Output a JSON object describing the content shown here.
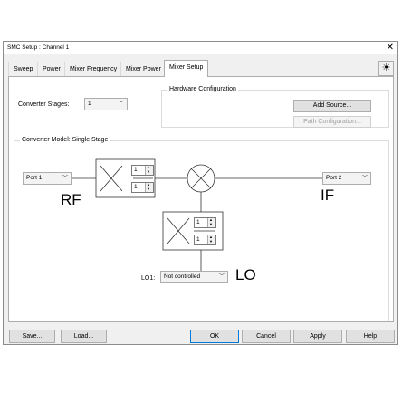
{
  "window": {
    "title": "SMC Setup : Channel 1",
    "close_icon": "✕"
  },
  "tabs": [
    "Sweep",
    "Power",
    "Mixer Frequency",
    "Mixer Power",
    "Mixer Setup"
  ],
  "active_tab": "Mixer Setup",
  "sun_icon": "☀",
  "converter_stages": {
    "label": "Converter Stages:",
    "value": "1"
  },
  "hardware": {
    "title": "Hardware Configuration",
    "add_source": "Add Source...",
    "path_configuration": "Path Configuration..."
  },
  "model": {
    "title": "Converter Model: Single Stage",
    "port_in": "Port 1",
    "port_out": "Port 2",
    "rf_label": "RF",
    "if_label": "IF",
    "lo_label": "LO",
    "lo1_label": "LO1:",
    "lo1_value": "Not controlled",
    "mult1_num": "1",
    "mult1_den": "1",
    "mult2_num": "1",
    "mult2_den": "1"
  },
  "footer": {
    "save": "Save...",
    "load": "Load...",
    "ok": "OK",
    "cancel": "Cancel",
    "apply": "Apply",
    "help": "Help"
  }
}
